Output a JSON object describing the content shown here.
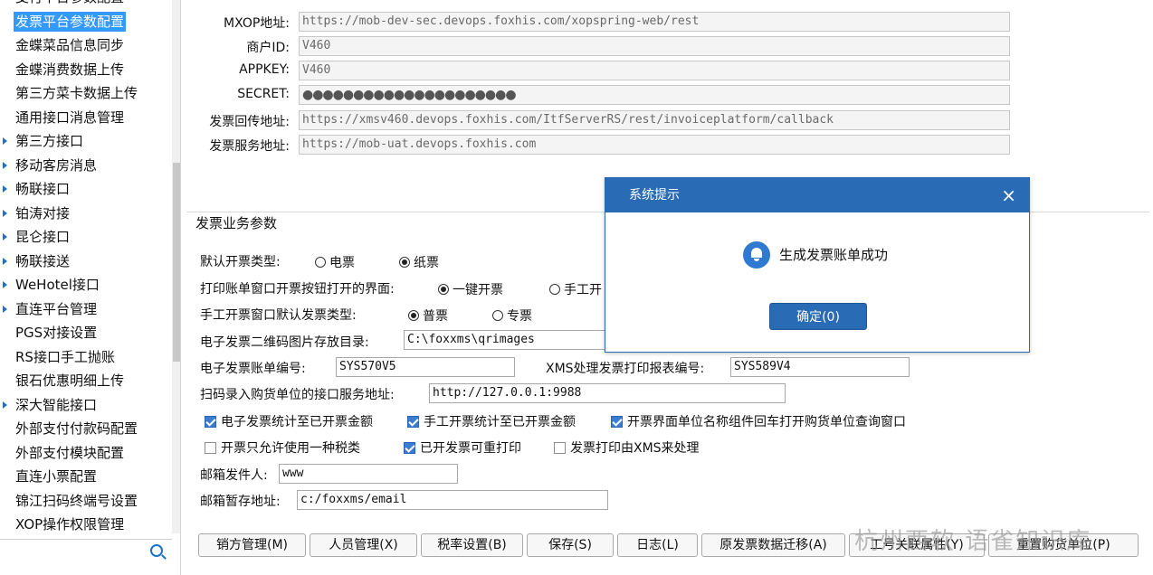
{
  "sidebar": {
    "items": [
      {
        "label": "支付平台参数配置",
        "arrow": false,
        "selected": false
      },
      {
        "label": "发票平台参数配置",
        "arrow": false,
        "selected": true
      },
      {
        "label": "金蝶菜品信息同步",
        "arrow": false,
        "selected": false
      },
      {
        "label": "金蝶消费数据上传",
        "arrow": false,
        "selected": false
      },
      {
        "label": "第三方菜卡数据上传",
        "arrow": false,
        "selected": false
      },
      {
        "label": "通用接口消息管理",
        "arrow": false,
        "selected": false
      },
      {
        "label": "第三方接口",
        "arrow": true,
        "selected": false
      },
      {
        "label": "移动客房消息",
        "arrow": true,
        "selected": false
      },
      {
        "label": "畅联接口",
        "arrow": true,
        "selected": false
      },
      {
        "label": "铂涛对接",
        "arrow": true,
        "selected": false
      },
      {
        "label": "昆仑接口",
        "arrow": true,
        "selected": false
      },
      {
        "label": "畅联接送",
        "arrow": true,
        "selected": false
      },
      {
        "label": "WeHotel接口",
        "arrow": true,
        "selected": false
      },
      {
        "label": "直连平台管理",
        "arrow": true,
        "selected": false
      },
      {
        "label": "PGS对接设置",
        "arrow": false,
        "selected": false
      },
      {
        "label": "RS接口手工抛账",
        "arrow": false,
        "selected": false
      },
      {
        "label": "银石优惠明细上传",
        "arrow": false,
        "selected": false
      },
      {
        "label": "深大智能接口",
        "arrow": true,
        "selected": false
      },
      {
        "label": "外部支付付款码配置",
        "arrow": false,
        "selected": false
      },
      {
        "label": "外部支付模块配置",
        "arrow": false,
        "selected": false
      },
      {
        "label": "直连小票配置",
        "arrow": false,
        "selected": false
      },
      {
        "label": "锦江扫码终端号设置",
        "arrow": false,
        "selected": false
      },
      {
        "label": "XOP操作权限管理",
        "arrow": false,
        "selected": false
      }
    ],
    "search_value": ""
  },
  "platform": {
    "mxop_label": "MXOP地址:",
    "mxop_value": "https://mob-dev-sec.devops.foxhis.com/xopspring-web/rest",
    "merchant_label": "商户ID:",
    "merchant_value": "V460",
    "appkey_label": "APPKEY:",
    "appkey_value": "V460",
    "secret_label": "SECRET:",
    "secret_value": "●●●●●●●●●●●●●●●●●●●●●",
    "callback_label": "发票回传地址:",
    "callback_value": "https://xmsv460.devops.foxhis.com/ItfServerRS/rest/invoiceplatform/callback",
    "service_label": "发票服务地址:",
    "service_value": "https://mob-uat.devops.foxhis.com"
  },
  "business": {
    "section_title": "发票业务参数",
    "default_type_label": "默认开票类型:",
    "default_type_opt1": "电票",
    "default_type_opt2": "纸票",
    "print_window_label": "打印账单窗口开票按钮打开的界面:",
    "print_window_opt1": "一键开票",
    "print_window_opt2": "手工开",
    "manual_type_label": "手工开票窗口默认发票类型:",
    "manual_type_opt1": "普票",
    "manual_type_opt2": "专票",
    "qr_dir_label": "电子发票二维码图片存放目录:",
    "qr_dir_value": "C:\\foxxms\\qrimages",
    "bill_no_label": "电子发票账单编号:",
    "bill_no_value": "SYS570V5",
    "xms_report_label": "XMS处理发票打印报表编号:",
    "xms_report_value": "SYS589V4",
    "scan_label": "扫码录入购货单位的接口服务地址:",
    "scan_value": "http://127.0.0.1:9988",
    "chk1": "电子发票统计至已开票金额",
    "chk2": "手工开票统计至已开票金额",
    "chk3": "开票界面单位名称组件回车打开购货单位查询窗口",
    "chk4": "开票只允许使用一种税类",
    "chk5": "已开发票可重打印",
    "chk6": "发票打印由XMS来处理",
    "mail_sender_label": "邮箱发件人:",
    "mail_sender_value": "www",
    "mail_dir_label": "邮箱暂存地址:",
    "mail_dir_value": "c:/foxxms/email"
  },
  "buttons": {
    "seller": "销方管理(M)",
    "staff": "人员管理(X)",
    "tax": "税率设置(B)",
    "save": "保存(S)",
    "log": "日志(L)",
    "migrate": "原发票数据迁移(A)",
    "cost": "工号关联属性(Y)",
    "recal": "重置购货单位(P)"
  },
  "watermark": "杭州西软 语雀知识库",
  "dialog": {
    "title": "系统提示",
    "close": "×",
    "message": "生成发票账单成功",
    "ok": "确定(0)"
  }
}
